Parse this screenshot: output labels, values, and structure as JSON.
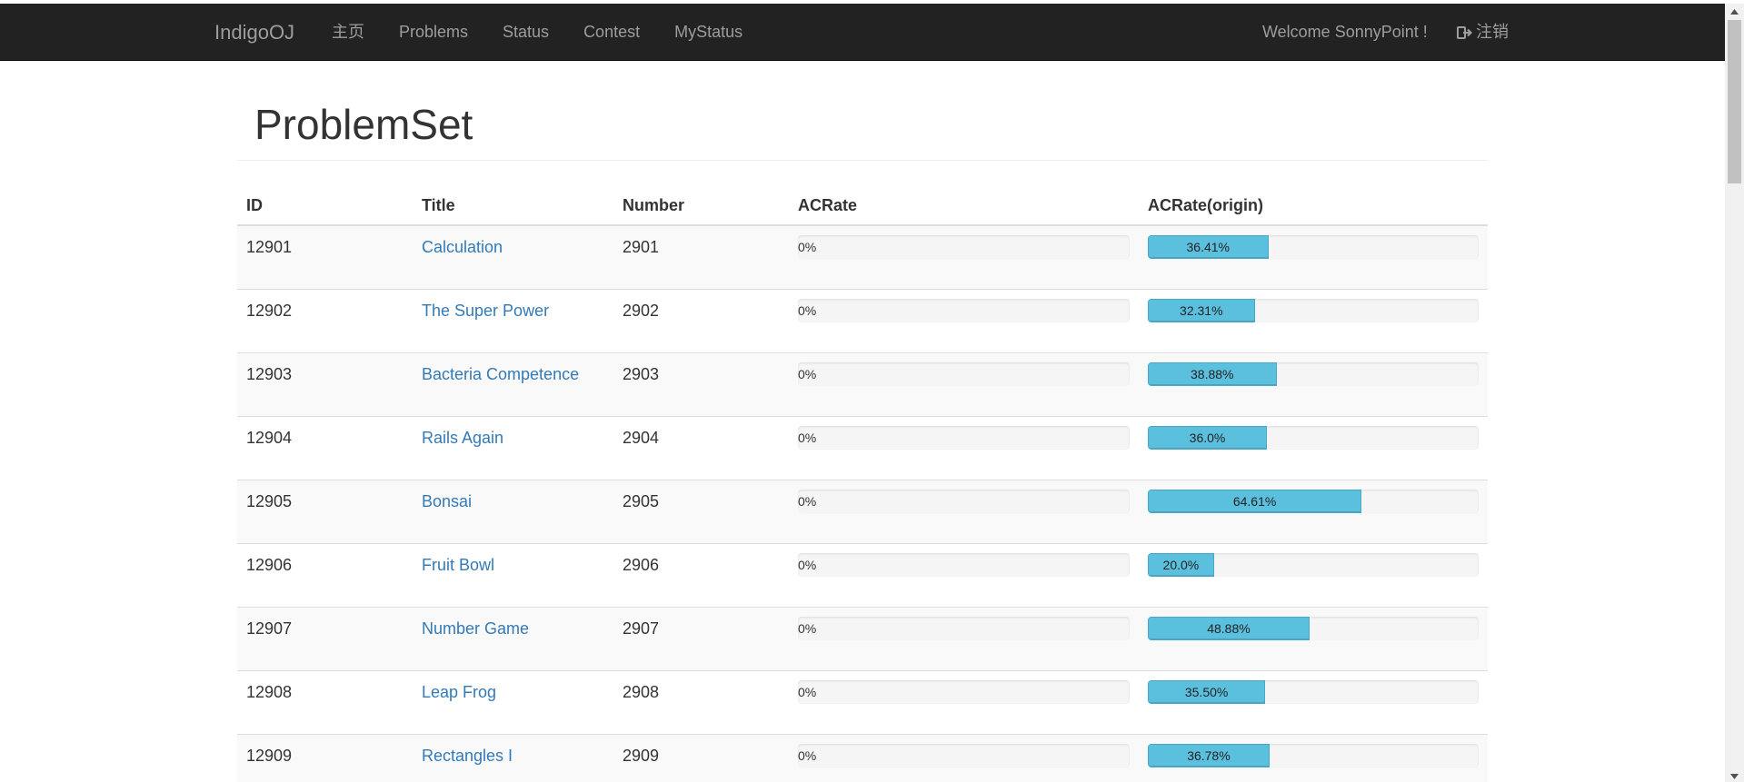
{
  "navbar": {
    "brand": "IndigoOJ",
    "links": [
      "主页",
      "Problems",
      "Status",
      "Contest",
      "MyStatus"
    ],
    "welcome": "Welcome SonnyPoint !",
    "logout": "注销"
  },
  "page": {
    "title": "ProblemSet"
  },
  "table": {
    "headers": [
      "ID",
      "Title",
      "Number",
      "ACRate",
      "ACRate(origin)"
    ],
    "rows": [
      {
        "id": "12901",
        "title": "Calculation",
        "number": "2901",
        "acrate": 0,
        "acrate_label": "0%",
        "origin": 36.41,
        "origin_label": "36.41%"
      },
      {
        "id": "12902",
        "title": "The Super Power",
        "number": "2902",
        "acrate": 0,
        "acrate_label": "0%",
        "origin": 32.31,
        "origin_label": "32.31%"
      },
      {
        "id": "12903",
        "title": "Bacteria Competence",
        "number": "2903",
        "acrate": 0,
        "acrate_label": "0%",
        "origin": 38.88,
        "origin_label": "38.88%"
      },
      {
        "id": "12904",
        "title": "Rails Again",
        "number": "2904",
        "acrate": 0,
        "acrate_label": "0%",
        "origin": 36.0,
        "origin_label": "36.0%"
      },
      {
        "id": "12905",
        "title": "Bonsai",
        "number": "2905",
        "acrate": 0,
        "acrate_label": "0%",
        "origin": 64.61,
        "origin_label": "64.61%"
      },
      {
        "id": "12906",
        "title": "Fruit Bowl",
        "number": "2906",
        "acrate": 0,
        "acrate_label": "0%",
        "origin": 20.0,
        "origin_label": "20.0%"
      },
      {
        "id": "12907",
        "title": "Number Game",
        "number": "2907",
        "acrate": 0,
        "acrate_label": "0%",
        "origin": 48.88,
        "origin_label": "48.88%"
      },
      {
        "id": "12908",
        "title": "Leap Frog",
        "number": "2908",
        "acrate": 0,
        "acrate_label": "0%",
        "origin": 35.5,
        "origin_label": "35.50%"
      },
      {
        "id": "12909",
        "title": "Rectangles I",
        "number": "2909",
        "acrate": 0,
        "acrate_label": "0%",
        "origin": 36.78,
        "origin_label": "36.78%"
      }
    ]
  },
  "colors": {
    "navbar_bg": "#222222",
    "link": "#337ab7",
    "progress_bar": "#5bc0de"
  },
  "icons": {
    "logout": "sign-out-icon"
  }
}
